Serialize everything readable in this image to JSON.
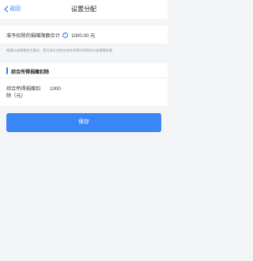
{
  "navbar": {
    "back_label": "返回",
    "title": "设置分配"
  },
  "total": {
    "label": "准予扣除的捐赠限额合计",
    "info_icon": "i",
    "amount": "1000.00 元"
  },
  "tip": "根据公益捐赠发生情况，您可自行决定在综合所得中扣除的公益捐赠金额",
  "section": {
    "title": "综合所得捐赠扣除",
    "field_label": "综合所得捐赠扣除（元）",
    "field_value": "1000"
  },
  "save_label": "保存",
  "colors": {
    "accent": "#2f7cf6",
    "button": "#3a86f7",
    "background": "#f4f5f7"
  }
}
